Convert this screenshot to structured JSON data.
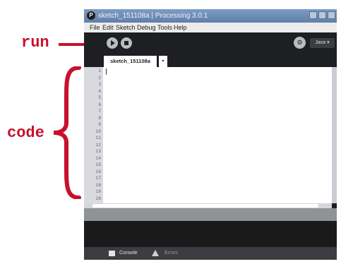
{
  "annotations": {
    "run": "run",
    "code": "code"
  },
  "window": {
    "title": "sketch_151108a | Processing 3.0.1",
    "logo": "P",
    "buttons": [
      "minimize-icon",
      "maximize-icon",
      "close-icon"
    ]
  },
  "menubar": {
    "items": [
      "File",
      "Edit",
      "Sketch",
      "Debug",
      "Tools",
      "Help"
    ]
  },
  "toolbar": {
    "run_icon": "play-icon",
    "stop_icon": "stop-icon",
    "debug_icon": "debugger-icon",
    "mode": "Java ▾"
  },
  "tabs": {
    "active": "sketch_151108a",
    "menu_icon": "▾"
  },
  "editor": {
    "line_numbers": [
      "1",
      "2",
      "3",
      "4",
      "5",
      "6",
      "7",
      "8",
      "9",
      "10",
      "11",
      "12",
      "13",
      "14",
      "15",
      "16",
      "17",
      "18",
      "19",
      "20"
    ]
  },
  "footer": {
    "console": "Console",
    "errors": "Errors"
  },
  "colors": {
    "annotation": "#c8102e",
    "titlebar": "#6f8fb8",
    "toolbar": "#1d1f22",
    "gutter": "#d8dade"
  }
}
